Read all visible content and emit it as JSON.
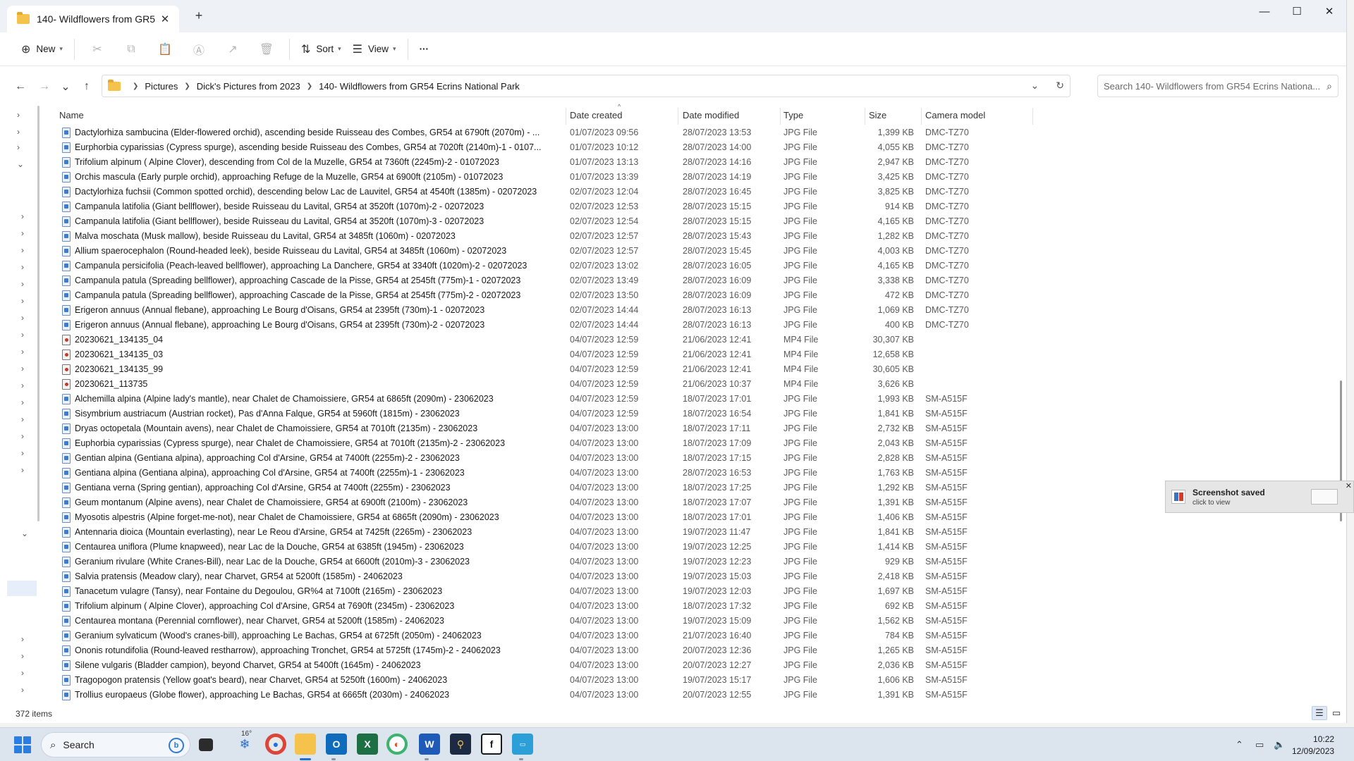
{
  "window": {
    "tab_title": "140- Wildflowers from GR5",
    "new_tab": "+",
    "minimize": "—",
    "maximize": "☐",
    "close": "✕"
  },
  "commandbar": {
    "new_label": "New",
    "sort_label": "Sort",
    "view_label": "View",
    "more_label": "···"
  },
  "address": {
    "crumbs": [
      "Pictures",
      "Dick's Pictures from 2023",
      "140- Wildflowers from GR54 Ecrins National Park"
    ]
  },
  "search": {
    "placeholder": "Search 140- Wildflowers from GR54 Ecrins Nationa..."
  },
  "columns": {
    "name": "Name",
    "date_created": "Date created",
    "date_modified": "Date modified",
    "type": "Type",
    "size": "Size",
    "camera_model": "Camera model"
  },
  "files": [
    {
      "name": "Dactylorhiza sambucina (Elder-flowered orchid), ascending beside Ruisseau des Combes, GR54 at 6790ft (2070m) - ...",
      "created": "01/07/2023 09:56",
      "modified": "28/07/2023 13:53",
      "type": "JPG File",
      "size": "1,399 KB",
      "camera": "DMC-TZ70"
    },
    {
      "name": "Eurphorbia cyparissias (Cypress spurge), ascending beside Ruisseau des Combes, GR54 at 7020ft (2140m)-1 - 0107...",
      "created": "01/07/2023 10:12",
      "modified": "28/07/2023 14:00",
      "type": "JPG File",
      "size": "4,055 KB",
      "camera": "DMC-TZ70"
    },
    {
      "name": "Trifolium alpinum ( Alpine Clover), descending from Col de la Muzelle, GR54 at 7360ft (2245m)-2 - 01072023",
      "created": "01/07/2023 13:13",
      "modified": "28/07/2023 14:16",
      "type": "JPG File",
      "size": "2,947 KB",
      "camera": "DMC-TZ70"
    },
    {
      "name": "Orchis mascula (Early purple orchid), approaching Refuge de la Muzelle, GR54 at 6900ft (2105m) - 01072023",
      "created": "01/07/2023 13:39",
      "modified": "28/07/2023 14:19",
      "type": "JPG File",
      "size": "3,425 KB",
      "camera": "DMC-TZ70"
    },
    {
      "name": "Dactylorhiza fuchsii (Common spotted orchid), descending below Lac de Lauvitel, GR54 at 4540ft (1385m) - 02072023",
      "created": "02/07/2023 12:04",
      "modified": "28/07/2023 16:45",
      "type": "JPG File",
      "size": "3,825 KB",
      "camera": "DMC-TZ70"
    },
    {
      "name": "Campanula latifolia (Giant bellflower), beside Ruisseau du Lavital, GR54 at 3520ft (1070m)-2 - 02072023",
      "created": "02/07/2023 12:53",
      "modified": "28/07/2023 15:15",
      "type": "JPG File",
      "size": "914 KB",
      "camera": "DMC-TZ70"
    },
    {
      "name": "Campanula latifolia (Giant bellflower), beside Ruisseau du Lavital, GR54 at 3520ft (1070m)-3 - 02072023",
      "created": "02/07/2023 12:54",
      "modified": "28/07/2023 15:15",
      "type": "JPG File",
      "size": "4,165 KB",
      "camera": "DMC-TZ70"
    },
    {
      "name": "Malva moschata (Musk mallow), beside Ruisseau du Lavital, GR54 at 3485ft (1060m) - 02072023",
      "created": "02/07/2023 12:57",
      "modified": "28/07/2023 15:43",
      "type": "JPG File",
      "size": "1,282 KB",
      "camera": "DMC-TZ70"
    },
    {
      "name": "Allium spaerocephalon (Round-headed leek), beside Ruisseau du Lavital, GR54 at 3485ft (1060m) - 02072023",
      "created": "02/07/2023 12:57",
      "modified": "28/07/2023 15:45",
      "type": "JPG File",
      "size": "4,003 KB",
      "camera": "DMC-TZ70"
    },
    {
      "name": "Campanula persicifolia (Peach-leaved bellflower), approaching La Danchere, GR54 at 3340ft (1020m)-2 - 02072023",
      "created": "02/07/2023 13:02",
      "modified": "28/07/2023 16:05",
      "type": "JPG File",
      "size": "4,165 KB",
      "camera": "DMC-TZ70"
    },
    {
      "name": "Campanula patula (Spreading bellflower), approaching Cascade de la Pisse, GR54 at 2545ft (775m)-1 - 02072023",
      "created": "02/07/2023 13:49",
      "modified": "28/07/2023 16:09",
      "type": "JPG File",
      "size": "3,338 KB",
      "camera": "DMC-TZ70"
    },
    {
      "name": "Campanula patula (Spreading bellflower), approaching Cascade de la Pisse, GR54 at 2545ft (775m)-2 - 02072023",
      "created": "02/07/2023 13:50",
      "modified": "28/07/2023 16:09",
      "type": "JPG File",
      "size": "472 KB",
      "camera": "DMC-TZ70"
    },
    {
      "name": "Erigeron annuus (Annual flebane), approaching Le Bourg d'Oisans, GR54 at 2395ft (730m)-1 - 02072023",
      "created": "02/07/2023 14:44",
      "modified": "28/07/2023 16:13",
      "type": "JPG File",
      "size": "1,069 KB",
      "camera": "DMC-TZ70"
    },
    {
      "name": "Erigeron annuus (Annual flebane), approaching Le Bourg d'Oisans, GR54 at 2395ft (730m)-2 - 02072023",
      "created": "02/07/2023 14:44",
      "modified": "28/07/2023 16:13",
      "type": "JPG File",
      "size": "400 KB",
      "camera": "DMC-TZ70"
    },
    {
      "name": "20230621_134135_04",
      "created": "04/07/2023 12:59",
      "modified": "21/06/2023 12:41",
      "type": "MP4 File",
      "size": "30,307 KB",
      "camera": ""
    },
    {
      "name": "20230621_134135_03",
      "created": "04/07/2023 12:59",
      "modified": "21/06/2023 12:41",
      "type": "MP4 File",
      "size": "12,658 KB",
      "camera": ""
    },
    {
      "name": "20230621_134135_99",
      "created": "04/07/2023 12:59",
      "modified": "21/06/2023 12:41",
      "type": "MP4 File",
      "size": "30,605 KB",
      "camera": ""
    },
    {
      "name": "20230621_113735",
      "created": "04/07/2023 12:59",
      "modified": "21/06/2023 10:37",
      "type": "MP4 File",
      "size": "3,626 KB",
      "camera": ""
    },
    {
      "name": "Alchemilla alpina (Alpine lady's mantle), near Chalet de Chamoissiere, GR54 at 6865ft (2090m) - 23062023",
      "created": "04/07/2023 12:59",
      "modified": "18/07/2023 17:01",
      "type": "JPG File",
      "size": "1,993 KB",
      "camera": "SM-A515F"
    },
    {
      "name": "Sisymbrium austriacum (Austrian rocket), Pas d'Anna Falque, GR54 at 5960ft (1815m) - 23062023",
      "created": "04/07/2023 12:59",
      "modified": "18/07/2023 16:54",
      "type": "JPG File",
      "size": "1,841 KB",
      "camera": "SM-A515F"
    },
    {
      "name": "Dryas octopetala (Mountain avens), near Chalet de Chamoissiere, GR54 at 7010ft (2135m) - 23062023",
      "created": "04/07/2023 13:00",
      "modified": "18/07/2023 17:11",
      "type": "JPG File",
      "size": "2,732 KB",
      "camera": "SM-A515F"
    },
    {
      "name": "Euphorbia cyparissias (Cypress spurge), near Chalet de Chamoissiere, GR54 at 7010ft (2135m)-2 - 23062023",
      "created": "04/07/2023 13:00",
      "modified": "18/07/2023 17:09",
      "type": "JPG File",
      "size": "2,043 KB",
      "camera": "SM-A515F"
    },
    {
      "name": "Gentian alpina (Gentiana alpina), approaching Col d'Arsine, GR54 at 7400ft (2255m)-2 - 23062023",
      "created": "04/07/2023 13:00",
      "modified": "18/07/2023 17:15",
      "type": "JPG File",
      "size": "2,828 KB",
      "camera": "SM-A515F"
    },
    {
      "name": "Gentiana alpina (Gentiana alpina), approaching Col d'Arsine, GR54 at 7400ft (2255m)-1 - 23062023",
      "created": "04/07/2023 13:00",
      "modified": "28/07/2023 16:53",
      "type": "JPG File",
      "size": "1,763 KB",
      "camera": "SM-A515F"
    },
    {
      "name": "Gentiana verna (Spring gentian), approaching Col d'Arsine, GR54 at 7400ft (2255m) - 23062023",
      "created": "04/07/2023 13:00",
      "modified": "18/07/2023 17:25",
      "type": "JPG File",
      "size": "1,292 KB",
      "camera": "SM-A515F"
    },
    {
      "name": "Geum montanum (Alpine avens), near Chalet de Chamoissiere, GR54 at 6900ft (2100m) - 23062023",
      "created": "04/07/2023 13:00",
      "modified": "18/07/2023 17:07",
      "type": "JPG File",
      "size": "1,391 KB",
      "camera": "SM-A515F"
    },
    {
      "name": "Myosotis alpestris (Alpine forget-me-not), near Chalet de Chamoissiere, GR54 at 6865ft (2090m) - 23062023",
      "created": "04/07/2023 13:00",
      "modified": "18/07/2023 17:01",
      "type": "JPG File",
      "size": "1,406 KB",
      "camera": "SM-A515F"
    },
    {
      "name": "Antennaria dioica (Mountain everlasting), near Le Reou d'Arsine, GR54 at 7425ft (2265m) - 23062023",
      "created": "04/07/2023 13:00",
      "modified": "19/07/2023 11:47",
      "type": "JPG File",
      "size": "1,841 KB",
      "camera": "SM-A515F"
    },
    {
      "name": "Centaurea uniflora (Plume knapweed), near Lac de la Douche, GR54 at 6385ft (1945m) - 23062023",
      "created": "04/07/2023 13:00",
      "modified": "19/07/2023 12:25",
      "type": "JPG File",
      "size": "1,414 KB",
      "camera": "SM-A515F"
    },
    {
      "name": "Geranium rivulare (White Cranes-Bill), near Lac de la Douche, GR54 at 6600ft (2010m)-3 - 23062023",
      "created": "04/07/2023 13:00",
      "modified": "19/07/2023 12:23",
      "type": "JPG File",
      "size": "929 KB",
      "camera": "SM-A515F"
    },
    {
      "name": "Salvia pratensis (Meadow clary), near Charvet, GR54 at 5200ft (1585m) - 24062023",
      "created": "04/07/2023 13:00",
      "modified": "19/07/2023 15:03",
      "type": "JPG File",
      "size": "2,418 KB",
      "camera": "SM-A515F"
    },
    {
      "name": "Tanacetum vulagre (Tansy), near Fontaine du Degoulou, GR%4 at 7100ft (2165m) - 23062023",
      "created": "04/07/2023 13:00",
      "modified": "19/07/2023 12:03",
      "type": "JPG File",
      "size": "1,697 KB",
      "camera": "SM-A515F"
    },
    {
      "name": "Trifolium alpinum ( Alpine Clover), approaching Col d'Arsine, GR54 at 7690ft (2345m) - 23062023",
      "created": "04/07/2023 13:00",
      "modified": "18/07/2023 17:32",
      "type": "JPG File",
      "size": "692 KB",
      "camera": "SM-A515F"
    },
    {
      "name": "Centaurea montana (Perennial cornflower), near Charvet, GR54 at 5200ft (1585m) - 24062023",
      "created": "04/07/2023 13:00",
      "modified": "19/07/2023 15:09",
      "type": "JPG File",
      "size": "1,562 KB",
      "camera": "SM-A515F"
    },
    {
      "name": "Geranium sylvaticum (Wood's cranes-bill),  approaching Le Bachas, GR54 at 6725ft (2050m) - 24062023",
      "created": "04/07/2023 13:00",
      "modified": "21/07/2023 16:40",
      "type": "JPG File",
      "size": "784 KB",
      "camera": "SM-A515F"
    },
    {
      "name": "Ononis rotundifolia (Round-leaved restharrow), approaching Tronchet, GR54 at 5725ft (1745m)-2 - 24062023",
      "created": "04/07/2023 13:00",
      "modified": "20/07/2023 12:36",
      "type": "JPG File",
      "size": "1,265 KB",
      "camera": "SM-A515F"
    },
    {
      "name": "Silene vulgaris (Bladder campion), beyond Charvet, GR54 at 5400ft (1645m) - 24062023",
      "created": "04/07/2023 13:00",
      "modified": "20/07/2023 12:27",
      "type": "JPG File",
      "size": "2,036 KB",
      "camera": "SM-A515F"
    },
    {
      "name": "Tragopogon pratensis (Yellow goat's beard), near Charvet, GR54 at 5250ft (1600m) - 24062023",
      "created": "04/07/2023 13:00",
      "modified": "19/07/2023 15:17",
      "type": "JPG File",
      "size": "1,606 KB",
      "camera": "SM-A515F"
    },
    {
      "name": "Trollius europaeus (Globe flower), approaching Le Bachas, GR54 at 6665ft (2030m) - 24062023",
      "created": "04/07/2023 13:00",
      "modified": "20/07/2023 12:55",
      "type": "JPG File",
      "size": "1,391 KB",
      "camera": "SM-A515F"
    }
  ],
  "status": {
    "item_count": "372 items"
  },
  "toast": {
    "title": "Screenshot saved",
    "subtitle": "click to view"
  },
  "taskbar": {
    "search_label": "Search",
    "weather_temp": "16°",
    "time": "10:22",
    "date": "12/09/2023"
  }
}
